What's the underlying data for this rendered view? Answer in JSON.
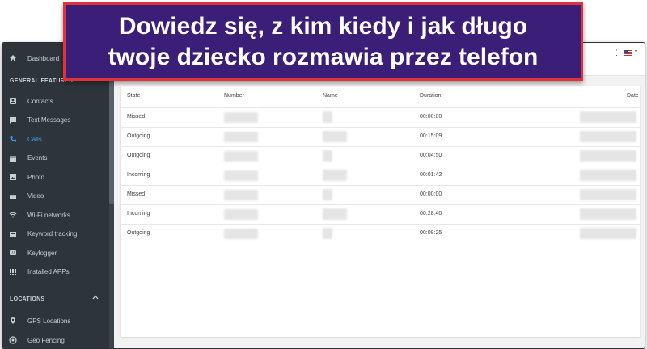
{
  "banner": {
    "line1": "Dowiedz się, z kim kiedy i jak długo",
    "line2": "twoje dziecko rozmawia przez telefon"
  },
  "sidebar": {
    "dashboard_label": "Dashboard",
    "general_features_label": "GENERAL FEATURES",
    "items": [
      {
        "label": "Contacts",
        "icon": "contacts-icon"
      },
      {
        "label": "Text Messages",
        "icon": "message-icon"
      },
      {
        "label": "Calls",
        "icon": "phone-icon"
      },
      {
        "label": "Events",
        "icon": "calendar-icon"
      },
      {
        "label": "Photo",
        "icon": "image-icon"
      },
      {
        "label": "Video",
        "icon": "video-icon"
      },
      {
        "label": "Wi-Fi networks",
        "icon": "wifi-icon"
      },
      {
        "label": "Keyword tracking",
        "icon": "keyword-icon"
      },
      {
        "label": "Keylogger",
        "icon": "keyboard-icon"
      },
      {
        "label": "Installed APPs",
        "icon": "apps-icon"
      }
    ],
    "active_item": "Calls",
    "locations_label": "LOCATIONS",
    "location_items": [
      {
        "label": "GPS Locations",
        "icon": "location-pin-icon"
      },
      {
        "label": "Geo Fencing",
        "icon": "geofence-icon"
      }
    ]
  },
  "table": {
    "headers": {
      "state": "State",
      "number": "Number",
      "name": "Name",
      "duration": "Duration",
      "date": "Date"
    },
    "rows": [
      {
        "state": "Missed",
        "duration": "00:00:00"
      },
      {
        "state": "Outgoing",
        "duration": "00:15:09"
      },
      {
        "state": "Outgoing",
        "duration": "00:04:50"
      },
      {
        "state": "Incoming",
        "duration": "00:01:42"
      },
      {
        "state": "Missed",
        "duration": "00:00:00"
      },
      {
        "state": "Incoming",
        "duration": "00:28:40"
      },
      {
        "state": "Outgoing",
        "duration": "00:08:25"
      }
    ]
  },
  "colors": {
    "sidebar_bg": "#2d343a",
    "active": "#3aa1e8",
    "banner_bg": "#3b1e78",
    "banner_border": "#e0313c"
  }
}
